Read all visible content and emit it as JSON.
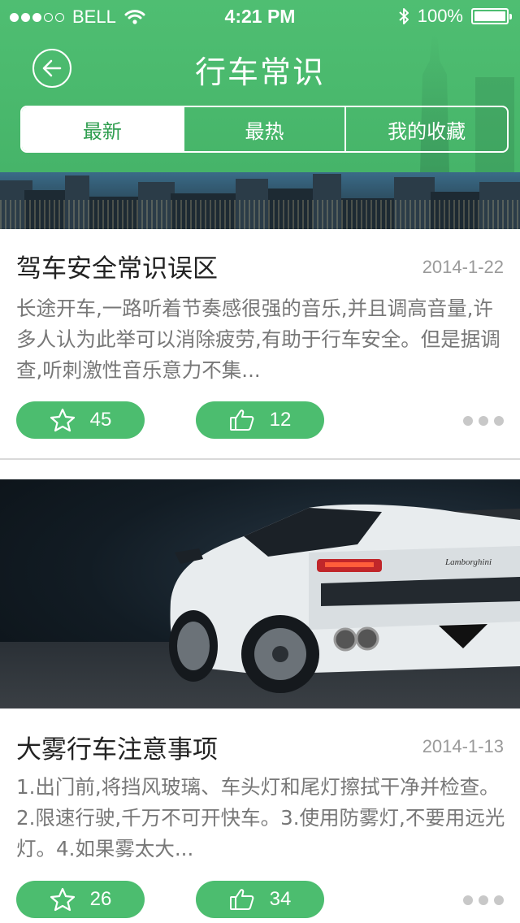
{
  "status_bar": {
    "carrier": "BELL",
    "time": "4:21 PM",
    "battery": "100%"
  },
  "nav": {
    "title": "行车常识"
  },
  "tabs": [
    {
      "label": "最新",
      "active": true
    },
    {
      "label": "最热",
      "active": false
    },
    {
      "label": "我的收藏",
      "active": false
    }
  ],
  "articles": [
    {
      "title": "驾车安全常识误区",
      "date": "2014-1-22",
      "body": "长途开车,一路听着节奏感很强的音乐,并且调高音量,许多人认为此举可以消除疲劳,有助于行车安全。但是据调查,听刺激性音乐意力不集...",
      "favorites": "45",
      "likes": "12"
    },
    {
      "title": "大雾行车注意事项",
      "date": "2014-1-13",
      "body": "1.出门前,将挡风玻璃、车头灯和尾灯擦拭干净并检查。2.限速行驶,千万不可开快车。3.使用防雾灯,不要用远光灯。4.如果雾太大...",
      "favorites": "26",
      "likes": "34",
      "image_text": "Lamborghini"
    }
  ],
  "colors": {
    "accent": "#4cbd6f",
    "header": "#4ab96d",
    "date_text": "#9a9a9a",
    "body_text": "#777777"
  },
  "icons": {
    "favorite": "star-icon",
    "like": "thumbs-up-icon",
    "back": "back-arrow-icon",
    "more": "more-dots-icon"
  }
}
